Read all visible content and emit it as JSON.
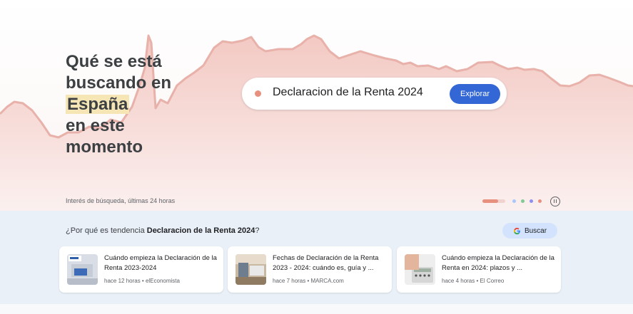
{
  "hero": {
    "headline_lines": [
      "Qué se está",
      "buscando en",
      "en este",
      "momento"
    ],
    "location": "España",
    "caption": "Interés de búsqueda, últimas 24 horas"
  },
  "trend": {
    "term": "Declaracion de la Renta 2024",
    "explore_label": "Explorar",
    "accent_color": "#e8907e",
    "button_color": "#3367d6",
    "pager": {
      "active_progress": 0.7,
      "dot_colors": [
        "#a8c7fa",
        "#81c995",
        "#8e8ff0",
        "#e8907e"
      ],
      "pause_icon": "pause-icon"
    }
  },
  "why": {
    "prefix": "¿Por qué es tendencia ",
    "term": "Declaracion de la Renta 2024",
    "suffix": "?",
    "search_label": "Buscar",
    "search_icon": "google-g-icon"
  },
  "articles": [
    {
      "title": "Cuándo empieza la Declaración de la Renta 2023-2024",
      "time": "hace 12 horas",
      "source": "elEconomista"
    },
    {
      "title": "Fechas de Declaración de la Renta 2023 - 2024: cuándo es, guía y ...",
      "time": "hace 7 horas",
      "source": "MARCA.com"
    },
    {
      "title": "Cuándo empieza la Declaración de la Renta en 2024: plazos y ...",
      "time": "hace 4 horas",
      "source": "El Correo"
    }
  ]
}
